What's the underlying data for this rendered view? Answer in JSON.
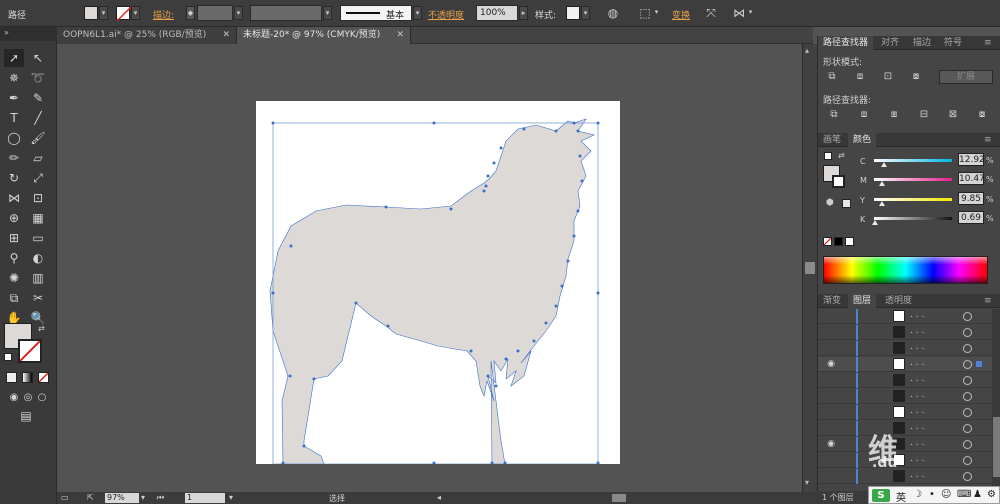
{
  "controlbar": {
    "selection_label": "路径",
    "stroke_label": "描边:",
    "stroke_style": "基本",
    "opacity_label": "不透明度",
    "opacity_value": "100%",
    "style_label": "样式:",
    "transform_label": "变换"
  },
  "tabs": [
    {
      "label": "OOPN6L1.ai* @ 25% (RGB/预览)"
    },
    {
      "label": "未标题-20* @ 97% (CMYK/预览)"
    }
  ],
  "panels": {
    "top_tabs": [
      "路径查找器",
      "对齐",
      "描边",
      "符号"
    ],
    "shape_modes_label": "形状模式:",
    "expand_label": "扩展",
    "pathfinder_label": "路径查找器:",
    "color_tabs": [
      "画笔",
      "颜色"
    ],
    "color_channels": [
      {
        "letter": "C",
        "value": "12.92",
        "frac": 0.13
      },
      {
        "letter": "M",
        "value": "10.47",
        "frac": 0.1
      },
      {
        "letter": "Y",
        "value": "9.85",
        "frac": 0.1
      },
      {
        "letter": "K",
        "value": "0.69",
        "frac": 0.01
      }
    ],
    "pct": "%",
    "layer_tabs": [
      "渐变",
      "图层",
      "透明度"
    ],
    "layer_count": "1 个图层",
    "fill_color": "#dcd9d6"
  },
  "status": {
    "zoom": "97%",
    "page": "1",
    "tool_name": "选择"
  },
  "ime": {
    "brand": "S",
    "lang": "英"
  },
  "watermark": {
    "char": "维",
    "text": ".du"
  }
}
